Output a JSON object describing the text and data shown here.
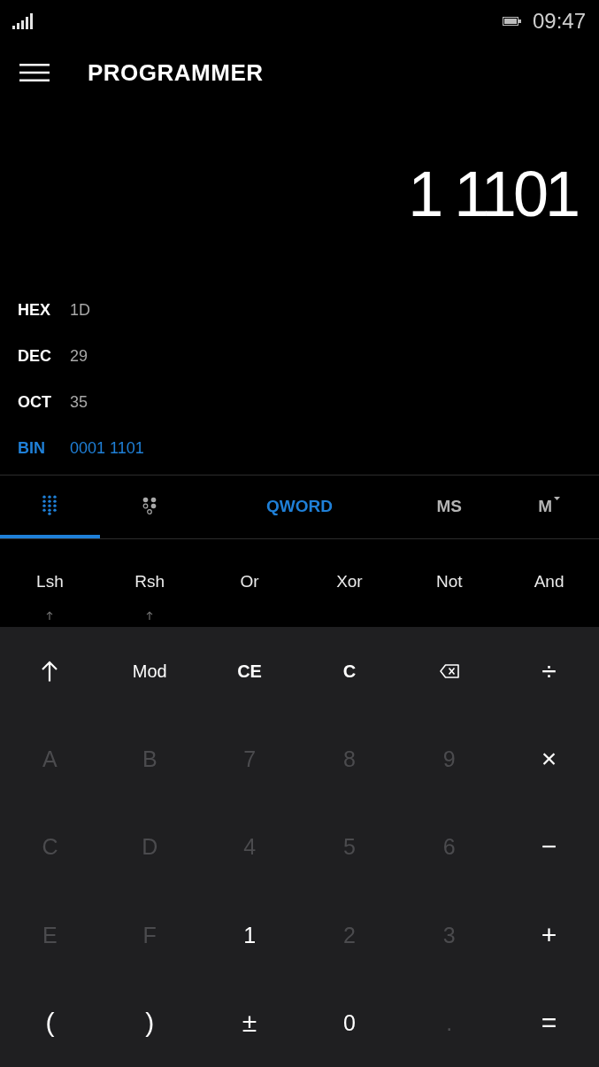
{
  "status_bar": {
    "time": "09:47"
  },
  "header": {
    "title": "PROGRAMMER"
  },
  "display": {
    "value": "1 1101"
  },
  "radix": [
    {
      "label": "HEX",
      "value": "1D",
      "selected": false
    },
    {
      "label": "DEC",
      "value": "29",
      "selected": false
    },
    {
      "label": "OCT",
      "value": "35",
      "selected": false
    },
    {
      "label": "BIN",
      "value": "0001 1101",
      "selected": true
    }
  ],
  "mode_tabs": [
    {
      "kind": "keypad",
      "selected": true
    },
    {
      "kind": "bits",
      "selected": false
    }
  ],
  "word_size": "QWORD",
  "memory": [
    {
      "label": "MS",
      "kind": "plain"
    },
    {
      "label": "M",
      "kind": "menu"
    }
  ],
  "bitwise_keys": [
    {
      "label": "Lsh",
      "kind": "shiftable"
    },
    {
      "label": "Rsh",
      "kind": "shiftable"
    },
    {
      "label": "Or",
      "kind": "plain"
    },
    {
      "label": "Xor",
      "kind": "plain"
    },
    {
      "label": "Not",
      "kind": "plain"
    },
    {
      "label": "And",
      "kind": "plain"
    }
  ],
  "keypad": [
    [
      {
        "kind": "shift",
        "disabled": false
      },
      {
        "kind": "function",
        "label": "Mod",
        "disabled": false
      },
      {
        "kind": "clear",
        "label": "CE",
        "disabled": false
      },
      {
        "kind": "clear",
        "label": "C",
        "disabled": false
      },
      {
        "kind": "backspace",
        "disabled": false
      },
      {
        "kind": "operator",
        "label": "÷",
        "disabled": false
      }
    ],
    [
      {
        "kind": "digit",
        "label": "A",
        "disabled": true
      },
      {
        "kind": "digit",
        "label": "B",
        "disabled": true
      },
      {
        "kind": "digit",
        "label": "7",
        "disabled": true
      },
      {
        "kind": "digit",
        "label": "8",
        "disabled": true
      },
      {
        "kind": "digit",
        "label": "9",
        "disabled": true
      },
      {
        "kind": "operator",
        "label": "×",
        "disabled": false
      }
    ],
    [
      {
        "kind": "digit",
        "label": "C",
        "disabled": true
      },
      {
        "kind": "digit",
        "label": "D",
        "disabled": true
      },
      {
        "kind": "digit",
        "label": "4",
        "disabled": true
      },
      {
        "kind": "digit",
        "label": "5",
        "disabled": true
      },
      {
        "kind": "digit",
        "label": "6",
        "disabled": true
      },
      {
        "kind": "operator",
        "label": "−",
        "disabled": false
      }
    ],
    [
      {
        "kind": "digit",
        "label": "E",
        "disabled": true
      },
      {
        "kind": "digit",
        "label": "F",
        "disabled": true
      },
      {
        "kind": "digit",
        "label": "1",
        "disabled": false
      },
      {
        "kind": "digit",
        "label": "2",
        "disabled": true
      },
      {
        "kind": "digit",
        "label": "3",
        "disabled": true
      },
      {
        "kind": "operator",
        "label": "+",
        "disabled": false
      }
    ],
    [
      {
        "kind": "operator",
        "label": "(",
        "disabled": false
      },
      {
        "kind": "operator",
        "label": ")",
        "disabled": false
      },
      {
        "kind": "operator",
        "label": "±",
        "disabled": false
      },
      {
        "kind": "digit",
        "label": "0",
        "disabled": false
      },
      {
        "kind": "digit",
        "label": ".",
        "disabled": true
      },
      {
        "kind": "operator",
        "label": "=",
        "disabled": false
      }
    ]
  ]
}
